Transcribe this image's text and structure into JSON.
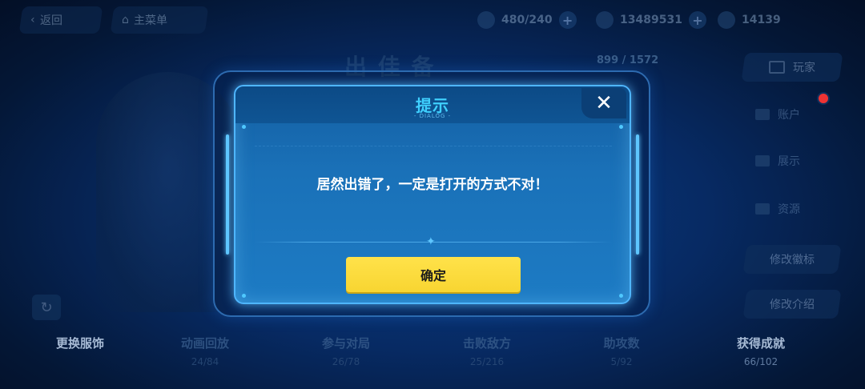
{
  "topbar": {
    "back_label": "返回",
    "main_menu_label": "主菜单",
    "stamina": "480/240",
    "coins": "13489531",
    "gems": "14139"
  },
  "background": {
    "title": "出 佳 备",
    "count": "899 / 1572",
    "side_tab_label": "玩家",
    "side_items": [
      "账户",
      "展示",
      "资源"
    ],
    "edit_badge_label": "修改徽标",
    "edit_intro_label": "修改介绍",
    "stats": [
      {
        "label": "更换服饰",
        "value": ""
      },
      {
        "label": "动画回放",
        "value": "24/84"
      },
      {
        "label": "参与对局",
        "value": "26/78"
      },
      {
        "label": "击败敌方",
        "value": "25/216"
      },
      {
        "label": "助攻数",
        "value": "5/92"
      },
      {
        "label": "获得成就",
        "value": "66/102"
      }
    ]
  },
  "dialog": {
    "title": "提示",
    "subtitle": "- DIALOG -",
    "close_glyph": "✕",
    "message": "居然出错了，一定是打开的方式不对！",
    "confirm_label": "确定",
    "accent_color": "#3fd0ff",
    "button_color": "#ffe24a"
  }
}
